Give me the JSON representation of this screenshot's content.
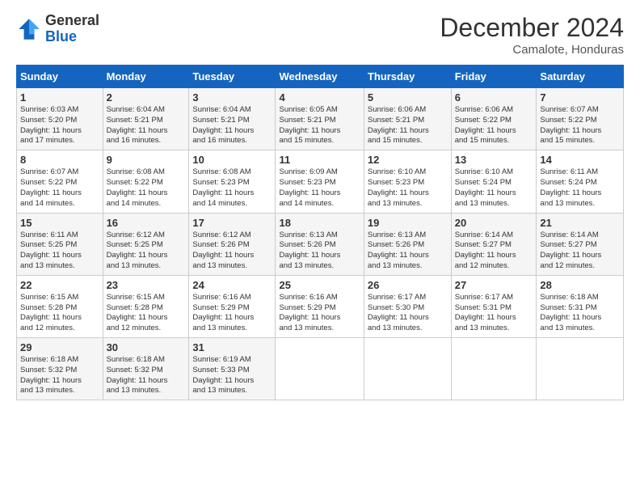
{
  "header": {
    "logo": {
      "line1": "General",
      "line2": "Blue"
    },
    "month": "December 2024",
    "location": "Camalote, Honduras"
  },
  "calendar": {
    "days": [
      "Sunday",
      "Monday",
      "Tuesday",
      "Wednesday",
      "Thursday",
      "Friday",
      "Saturday"
    ],
    "weeks": [
      [
        {
          "day": "1",
          "info": "Sunrise: 6:03 AM\nSunset: 5:20 PM\nDaylight: 11 hours\nand 17 minutes."
        },
        {
          "day": "2",
          "info": "Sunrise: 6:04 AM\nSunset: 5:21 PM\nDaylight: 11 hours\nand 16 minutes."
        },
        {
          "day": "3",
          "info": "Sunrise: 6:04 AM\nSunset: 5:21 PM\nDaylight: 11 hours\nand 16 minutes."
        },
        {
          "day": "4",
          "info": "Sunrise: 6:05 AM\nSunset: 5:21 PM\nDaylight: 11 hours\nand 15 minutes."
        },
        {
          "day": "5",
          "info": "Sunrise: 6:06 AM\nSunset: 5:21 PM\nDaylight: 11 hours\nand 15 minutes."
        },
        {
          "day": "6",
          "info": "Sunrise: 6:06 AM\nSunset: 5:22 PM\nDaylight: 11 hours\nand 15 minutes."
        },
        {
          "day": "7",
          "info": "Sunrise: 6:07 AM\nSunset: 5:22 PM\nDaylight: 11 hours\nand 15 minutes."
        }
      ],
      [
        {
          "day": "8",
          "info": "Sunrise: 6:07 AM\nSunset: 5:22 PM\nDaylight: 11 hours\nand 14 minutes."
        },
        {
          "day": "9",
          "info": "Sunrise: 6:08 AM\nSunset: 5:22 PM\nDaylight: 11 hours\nand 14 minutes."
        },
        {
          "day": "10",
          "info": "Sunrise: 6:08 AM\nSunset: 5:23 PM\nDaylight: 11 hours\nand 14 minutes."
        },
        {
          "day": "11",
          "info": "Sunrise: 6:09 AM\nSunset: 5:23 PM\nDaylight: 11 hours\nand 14 minutes."
        },
        {
          "day": "12",
          "info": "Sunrise: 6:10 AM\nSunset: 5:23 PM\nDaylight: 11 hours\nand 13 minutes."
        },
        {
          "day": "13",
          "info": "Sunrise: 6:10 AM\nSunset: 5:24 PM\nDaylight: 11 hours\nand 13 minutes."
        },
        {
          "day": "14",
          "info": "Sunrise: 6:11 AM\nSunset: 5:24 PM\nDaylight: 11 hours\nand 13 minutes."
        }
      ],
      [
        {
          "day": "15",
          "info": "Sunrise: 6:11 AM\nSunset: 5:25 PM\nDaylight: 11 hours\nand 13 minutes."
        },
        {
          "day": "16",
          "info": "Sunrise: 6:12 AM\nSunset: 5:25 PM\nDaylight: 11 hours\nand 13 minutes."
        },
        {
          "day": "17",
          "info": "Sunrise: 6:12 AM\nSunset: 5:26 PM\nDaylight: 11 hours\nand 13 minutes."
        },
        {
          "day": "18",
          "info": "Sunrise: 6:13 AM\nSunset: 5:26 PM\nDaylight: 11 hours\nand 13 minutes."
        },
        {
          "day": "19",
          "info": "Sunrise: 6:13 AM\nSunset: 5:26 PM\nDaylight: 11 hours\nand 13 minutes."
        },
        {
          "day": "20",
          "info": "Sunrise: 6:14 AM\nSunset: 5:27 PM\nDaylight: 11 hours\nand 12 minutes."
        },
        {
          "day": "21",
          "info": "Sunrise: 6:14 AM\nSunset: 5:27 PM\nDaylight: 11 hours\nand 12 minutes."
        }
      ],
      [
        {
          "day": "22",
          "info": "Sunrise: 6:15 AM\nSunset: 5:28 PM\nDaylight: 11 hours\nand 12 minutes."
        },
        {
          "day": "23",
          "info": "Sunrise: 6:15 AM\nSunset: 5:28 PM\nDaylight: 11 hours\nand 12 minutes."
        },
        {
          "day": "24",
          "info": "Sunrise: 6:16 AM\nSunset: 5:29 PM\nDaylight: 11 hours\nand 13 minutes."
        },
        {
          "day": "25",
          "info": "Sunrise: 6:16 AM\nSunset: 5:29 PM\nDaylight: 11 hours\nand 13 minutes."
        },
        {
          "day": "26",
          "info": "Sunrise: 6:17 AM\nSunset: 5:30 PM\nDaylight: 11 hours\nand 13 minutes."
        },
        {
          "day": "27",
          "info": "Sunrise: 6:17 AM\nSunset: 5:31 PM\nDaylight: 11 hours\nand 13 minutes."
        },
        {
          "day": "28",
          "info": "Sunrise: 6:18 AM\nSunset: 5:31 PM\nDaylight: 11 hours\nand 13 minutes."
        }
      ],
      [
        {
          "day": "29",
          "info": "Sunrise: 6:18 AM\nSunset: 5:32 PM\nDaylight: 11 hours\nand 13 minutes."
        },
        {
          "day": "30",
          "info": "Sunrise: 6:18 AM\nSunset: 5:32 PM\nDaylight: 11 hours\nand 13 minutes."
        },
        {
          "day": "31",
          "info": "Sunrise: 6:19 AM\nSunset: 5:33 PM\nDaylight: 11 hours\nand 13 minutes."
        },
        null,
        null,
        null,
        null
      ]
    ]
  }
}
